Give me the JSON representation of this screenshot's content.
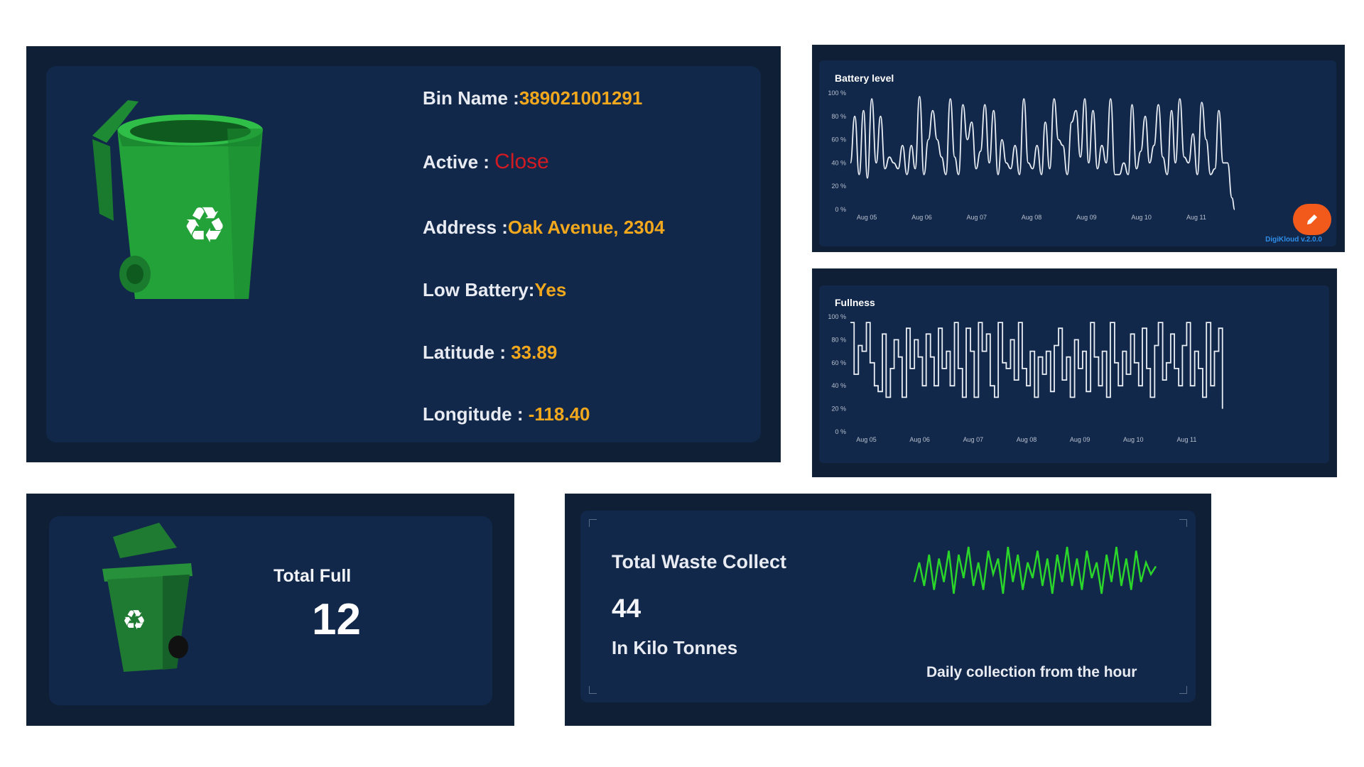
{
  "bin_info": {
    "fields": [
      {
        "label": "Bin Name :",
        "value": "389021001291"
      },
      {
        "label": "Active : ",
        "value": "Close"
      },
      {
        "label": "Address :",
        "value": "Oak Avenue, 2304"
      },
      {
        "label": "Low Battery:",
        "value": "Yes"
      },
      {
        "label": "Latitude : ",
        "value": "33.89"
      },
      {
        "label": "Longitude : ",
        "value": "-118.40"
      }
    ]
  },
  "colors": {
    "panel_bg": "#0e1f36",
    "card_bg": "#12284a",
    "value_accent": "#f2a81d",
    "status_close": "#d21a22",
    "sparkline": "#2bd62b",
    "fab": "#f25a1c",
    "version_link": "#2f8ee8"
  },
  "battery_chart": {
    "version": "DigiKloud v.2.0.0",
    "fab_icon": "pencil-icon"
  },
  "total_full": {
    "label": "Total Full",
    "value": "12"
  },
  "waste": {
    "title": "Total Waste Collect",
    "value": "44",
    "unit": "In Kilo Tonnes",
    "caption": "Daily collection from the hour",
    "sparkline_values": [
      45,
      70,
      40,
      80,
      35,
      75,
      45,
      85,
      30,
      80,
      50,
      90,
      40,
      70,
      35,
      85,
      55,
      75,
      30,
      90,
      45,
      80,
      35,
      70,
      50,
      85,
      40,
      75,
      30,
      80,
      45,
      90,
      40,
      75,
      35,
      85,
      50,
      70,
      30,
      80,
      45,
      90,
      40,
      75,
      35,
      85,
      45,
      70,
      55,
      65
    ]
  },
  "chart_data": [
    {
      "type": "line",
      "title": "Battery level",
      "x_ticks": [
        "Aug 05",
        "Aug 06",
        "Aug 07",
        "Aug 08",
        "Aug 09",
        "Aug 10",
        "Aug 11"
      ],
      "y_ticks": [
        "0 %",
        "20 %",
        "40 %",
        "60 %",
        "80 %",
        "100 %"
      ],
      "ylim": [
        0,
        100
      ],
      "x_range": [
        0,
        7
      ],
      "series": [
        {
          "x": [
            0,
            0.08,
            0.16,
            0.24,
            0.31,
            0.39,
            0.47,
            0.55,
            0.63,
            0.71,
            0.79,
            0.87,
            0.95,
            1.03,
            1.11,
            1.18,
            1.26,
            1.34,
            1.42,
            1.5,
            1.58,
            1.66,
            1.74,
            1.82,
            1.9,
            1.97,
            2.05,
            2.13,
            2.21,
            2.29,
            2.37,
            2.45,
            2.53,
            2.61,
            2.69,
            2.76,
            2.84,
            2.92,
            3.0,
            3.08,
            3.16,
            3.24,
            3.32,
            3.4,
            3.48,
            3.55,
            3.63,
            3.71,
            3.79,
            3.87,
            3.95,
            4.03,
            4.11,
            4.19,
            4.27,
            4.34,
            4.42,
            4.5,
            4.58,
            4.66,
            4.74,
            4.82,
            4.9,
            4.98,
            5.06,
            5.13,
            5.21,
            5.29,
            5.37,
            5.45,
            5.53,
            5.61,
            5.69,
            5.77,
            5.85,
            5.92,
            6.0,
            6.08,
            6.16,
            6.24,
            6.32,
            6.4,
            6.48,
            6.56,
            6.64,
            6.71,
            6.79,
            6.87,
            6.95,
            7.0
          ],
          "y": [
            40,
            80,
            30,
            85,
            27,
            95,
            40,
            80,
            35,
            45,
            40,
            35,
            55,
            30,
            55,
            35,
            97,
            30,
            60,
            85,
            60,
            45,
            30,
            95,
            45,
            30,
            90,
            60,
            75,
            35,
            50,
            90,
            40,
            85,
            30,
            60,
            40,
            35,
            55,
            30,
            95,
            40,
            35,
            55,
            30,
            75,
            35,
            95,
            60,
            55,
            30,
            75,
            85,
            45,
            95,
            40,
            85,
            35,
            55,
            40,
            95,
            30,
            30,
            40,
            30,
            90,
            35,
            50,
            80,
            40,
            55,
            90,
            45,
            30,
            85,
            40,
            95,
            45,
            40,
            65,
            30,
            92,
            60,
            30,
            35,
            85,
            40,
            40,
            10,
            0
          ]
        }
      ]
    },
    {
      "type": "line",
      "title": "Fullness",
      "x_ticks": [
        "Aug 05",
        "Aug 06",
        "Aug 07",
        "Aug 08",
        "Aug 09",
        "Aug 10",
        "Aug 11"
      ],
      "y_ticks": [
        "0 %",
        "20 %",
        "40 %",
        "60 %",
        "80 %",
        "100 %"
      ],
      "ylim": [
        0,
        100
      ],
      "x_range": [
        0,
        7
      ],
      "series": [
        {
          "x": [
            0,
            0.07,
            0.15,
            0.22,
            0.3,
            0.37,
            0.45,
            0.52,
            0.6,
            0.67,
            0.75,
            0.82,
            0.9,
            0.97,
            1.05,
            1.12,
            1.2,
            1.27,
            1.35,
            1.42,
            1.5,
            1.57,
            1.65,
            1.72,
            1.8,
            1.87,
            1.95,
            2.02,
            2.1,
            2.17,
            2.25,
            2.32,
            2.4,
            2.47,
            2.55,
            2.62,
            2.7,
            2.77,
            2.85,
            2.92,
            3.0,
            3.07,
            3.15,
            3.22,
            3.3,
            3.37,
            3.45,
            3.52,
            3.6,
            3.67,
            3.75,
            3.82,
            3.9,
            3.97,
            4.05,
            4.12,
            4.2,
            4.27,
            4.35,
            4.42,
            4.5,
            4.57,
            4.65,
            4.72,
            4.8,
            4.87,
            4.95,
            5.02,
            5.1,
            5.17,
            5.25,
            5.32,
            5.4,
            5.47,
            5.55,
            5.62,
            5.7,
            5.77,
            5.85,
            5.92,
            6.0,
            6.07,
            6.15,
            6.22,
            6.3,
            6.37,
            6.45,
            6.52,
            6.6,
            6.67,
            6.75,
            6.82,
            6.9,
            6.97
          ],
          "y": [
            95,
            50,
            75,
            70,
            95,
            60,
            40,
            35,
            85,
            30,
            55,
            80,
            65,
            30,
            90,
            55,
            80,
            65,
            40,
            85,
            65,
            40,
            90,
            55,
            70,
            40,
            95,
            55,
            30,
            90,
            70,
            30,
            95,
            70,
            85,
            40,
            30,
            95,
            60,
            55,
            80,
            45,
            95,
            55,
            40,
            70,
            30,
            65,
            50,
            70,
            35,
            75,
            90,
            45,
            65,
            30,
            80,
            55,
            70,
            35,
            95,
            65,
            40,
            70,
            30,
            95,
            60,
            40,
            70,
            50,
            85,
            60,
            40,
            90,
            55,
            30,
            75,
            95,
            45,
            60,
            85,
            55,
            40,
            75,
            95,
            40,
            70,
            55,
            30,
            95,
            40,
            70,
            90,
            20
          ]
        }
      ]
    }
  ]
}
